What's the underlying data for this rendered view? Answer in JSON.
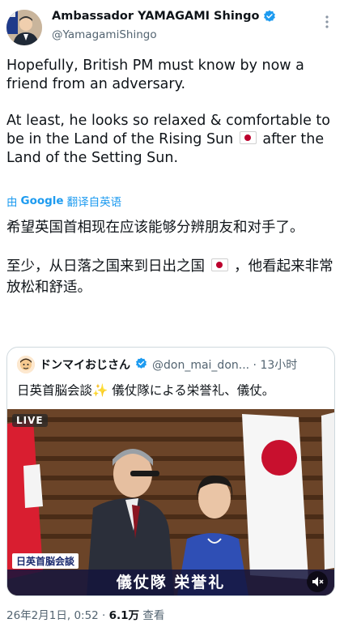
{
  "author": {
    "display_name": "Ambassador YAMAGAMI Shingo",
    "handle": "@YamagamiShingo"
  },
  "tweet": {
    "line1": "Hopefully, British PM must know by now a friend from an adversary.",
    "line2_a": "At least, he looks so relaxed  & comfortable to be in the Land of the Rising Sun",
    "line2_b": "after the Land of the Setting Sun."
  },
  "translation": {
    "prefix": "由",
    "google": "Google",
    "label": "翻译自英语",
    "p1": "希望英国首相现在应该能够分辨朋友和对手了。",
    "p2_a": "至少，从日落之国来到日出之国",
    "p2_b": "，他看起来非常放松和舒适。"
  },
  "quoted": {
    "name": "ドンマイおじさん",
    "handle_time": "@don_mai_don... · 13小时",
    "text": "日英首脳会談✨ 儀仗隊による栄誉礼、儀仗。",
    "live_label": "LIVE",
    "caption_small": "日英首脳会談",
    "caption_big": "儀仗隊 栄誉礼"
  },
  "meta": {
    "date": "26年2月1日, 0:52 · ",
    "views": "6.1万",
    "views_label": " 查看"
  },
  "colors": {
    "link_blue": "#1d9bf0",
    "verified_blue": "#1d9bf0",
    "flag_red": "#bc002d"
  },
  "icons": [
    "verified-badge-icon",
    "more-options-icon",
    "japan-flag-icon",
    "mute-icon"
  ]
}
